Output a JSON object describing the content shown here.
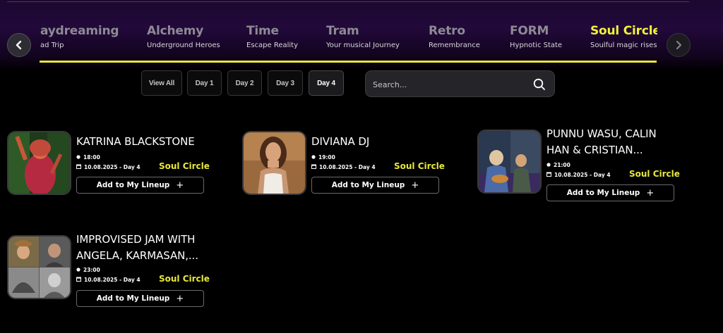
{
  "stages": [
    {
      "name": "aydreaming",
      "subtitle": "ad Trip",
      "active": false
    },
    {
      "name": "Alchemy",
      "subtitle": "Underground Heroes",
      "active": false
    },
    {
      "name": "Time",
      "subtitle": "Escape Reality",
      "active": false
    },
    {
      "name": "Tram",
      "subtitle": "Your musical Journey",
      "active": false
    },
    {
      "name": "Retro",
      "subtitle": "Remembrance",
      "active": false
    },
    {
      "name": "FORM",
      "subtitle": "Hypnotic State",
      "active": false
    },
    {
      "name": "Soul Circle",
      "subtitle": "Soulful magic rises",
      "active": true
    }
  ],
  "nav": {
    "prev_icon": "chevron-left-icon",
    "next_icon": "chevron-right-icon"
  },
  "days": [
    {
      "label": "View All",
      "active": false
    },
    {
      "label": "Day 1",
      "active": false
    },
    {
      "label": "Day 2",
      "active": false
    },
    {
      "label": "Day 3",
      "active": false
    },
    {
      "label": "Day 4",
      "active": true
    }
  ],
  "search": {
    "placeholder": "Search...",
    "value": "",
    "icon": "search-icon"
  },
  "performances": [
    {
      "artist_lines": [
        "KATRINA BLACKSTONE"
      ],
      "time": "18:00",
      "date": "10.08.2025 - Day 4",
      "stage": "Soul Circle",
      "button_label": "Add to My Lineup",
      "button_icon": "+"
    },
    {
      "artist_lines": [
        "DIVIANA DJ"
      ],
      "time": "19:00",
      "date": "10.08.2025 - Day 4",
      "stage": "Soul Circle",
      "button_label": "Add to My Lineup",
      "button_icon": "+"
    },
    {
      "artist_lines": [
        "PUNNU WASU, CALIN",
        "HAN & CRISTIAN..."
      ],
      "time": "21:00",
      "date": "10.08.2025 - Day 4",
      "stage": "Soul Circle",
      "button_label": "Add to My Lineup",
      "button_icon": "+"
    },
    {
      "artist_lines": [
        "IMPROVISED JAM WITH",
        "ANGELA, KARMASAN,..."
      ],
      "time": "23:00",
      "date": "10.08.2025 - Day 4",
      "stage": "Soul Circle",
      "button_label": "Add to My Lineup",
      "button_icon": "+"
    }
  ],
  "colors": {
    "accent": "#e8e83a",
    "background": "#000000",
    "header_gradient": "#22093a"
  }
}
